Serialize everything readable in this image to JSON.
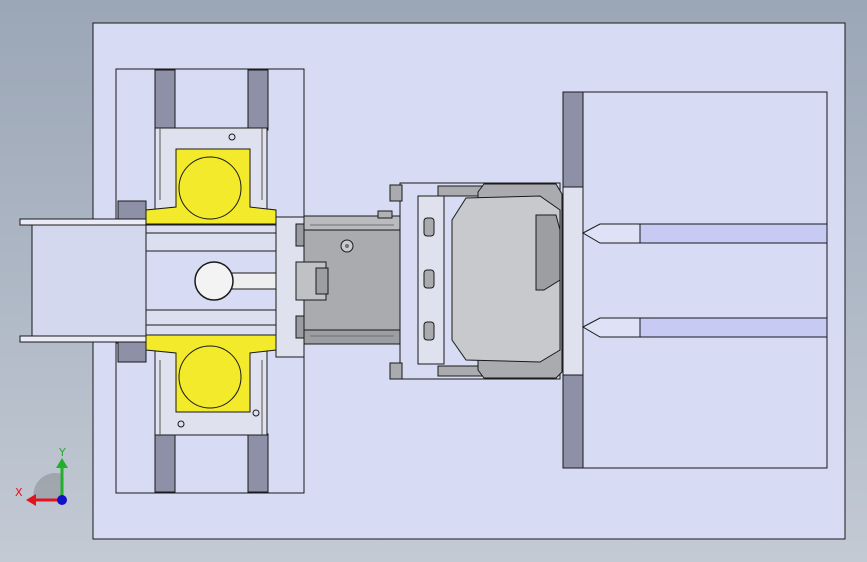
{
  "view": {
    "background_top": "#9ba6b6",
    "background_bottom": "#c3cad4",
    "part_fill": "#d7dcf4",
    "highlight_fill": "#f2ea2b",
    "steel_fill": "#a9abaf",
    "slot_fill": "#8d90a6",
    "edge_color": "#1a1a1a"
  },
  "triad": {
    "x_label": "X",
    "y_label": "Y",
    "x_color": "#e0141c",
    "y_color": "#22b02c",
    "z_color": "#1010c8",
    "icon": "coordinate-triad-icon"
  }
}
